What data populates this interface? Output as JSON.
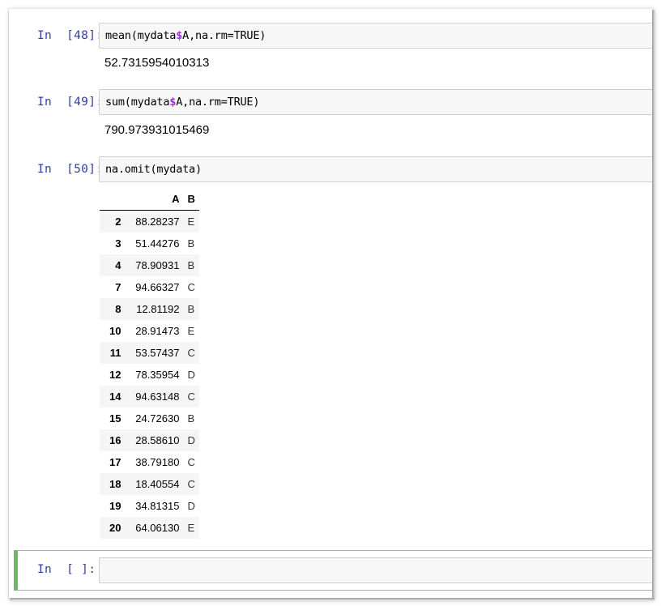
{
  "cells": [
    {
      "prompt": "In  [48]:",
      "code_before": "mean(mydata",
      "code_dollar": "$",
      "code_after": "A,na.rm=TRUE)",
      "output": "52.7315954010313"
    },
    {
      "prompt": "In  [49]:",
      "code_before": "sum(mydata",
      "code_dollar": "$",
      "code_after": "A,na.rm=TRUE)",
      "output": "790.973931015469"
    },
    {
      "prompt": "In  [50]:",
      "code": "na.omit(mydata)"
    }
  ],
  "dataframe": {
    "columns": [
      "A",
      "B"
    ],
    "rows": [
      {
        "index": "2",
        "A": "88.28237",
        "B": "E"
      },
      {
        "index": "3",
        "A": "51.44276",
        "B": "B"
      },
      {
        "index": "4",
        "A": "78.90931",
        "B": "B"
      },
      {
        "index": "7",
        "A": "94.66327",
        "B": "C"
      },
      {
        "index": "8",
        "A": "12.81192",
        "B": "B"
      },
      {
        "index": "10",
        "A": "28.91473",
        "B": "E"
      },
      {
        "index": "11",
        "A": "53.57437",
        "B": "C"
      },
      {
        "index": "12",
        "A": "78.35954",
        "B": "D"
      },
      {
        "index": "14",
        "A": "94.63148",
        "B": "C"
      },
      {
        "index": "15",
        "A": "24.72630",
        "B": "B"
      },
      {
        "index": "16",
        "A": "28.58610",
        "B": "D"
      },
      {
        "index": "17",
        "A": "38.79180",
        "B": "C"
      },
      {
        "index": "18",
        "A": "18.40554",
        "B": "C"
      },
      {
        "index": "19",
        "A": "34.81315",
        "B": "D"
      },
      {
        "index": "20",
        "A": "64.06130",
        "B": "E"
      }
    ]
  },
  "empty_cell": {
    "prompt": "In  [ ]:",
    "code": ""
  },
  "colors": {
    "prompt": "#303f9f",
    "dollar": "#aa22ff",
    "selected_border": "#66bb6a",
    "input_bg": "#f7f7f7"
  }
}
